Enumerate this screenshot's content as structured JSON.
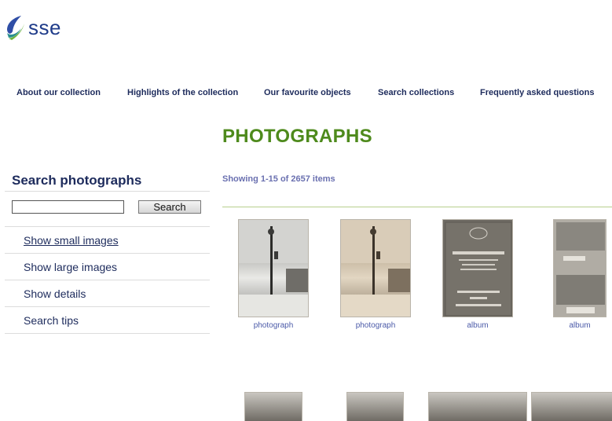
{
  "brand": {
    "logo_text": "sse",
    "colors": {
      "green": "#4e8a1c",
      "navy": "#1d2b5c",
      "link": "#4b5aa8"
    }
  },
  "nav": {
    "items": [
      "About our collection",
      "Highlights of the collection",
      "Our favourite objects",
      "Search collections",
      "Frequently asked questions"
    ]
  },
  "page": {
    "title": "PHOTOGRAPHS"
  },
  "sidebar": {
    "heading": "Search photographs",
    "search": {
      "value": "",
      "button_label": "Search"
    },
    "links": [
      {
        "label": "Show small images",
        "active": true
      },
      {
        "label": "Show large images",
        "active": false
      },
      {
        "label": "Show details",
        "active": false
      },
      {
        "label": "Search tips",
        "active": false
      }
    ]
  },
  "results": {
    "showing": "Showing 1-15 of 2657 items",
    "items": [
      {
        "caption": "photograph"
      },
      {
        "caption": "photograph"
      },
      {
        "caption": "album"
      },
      {
        "caption": "album"
      }
    ]
  }
}
